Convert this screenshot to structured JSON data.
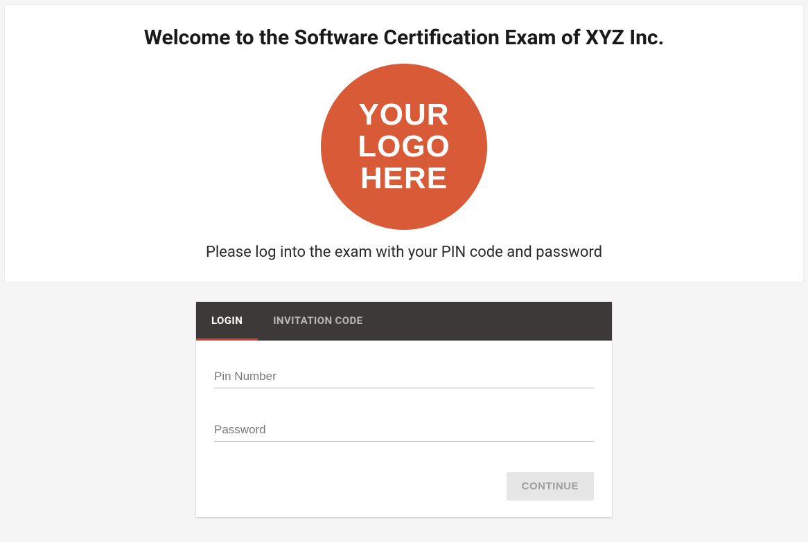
{
  "header": {
    "title": "Welcome to the Software Certification Exam of XYZ Inc.",
    "logo": {
      "line1": "YOUR",
      "line2": "LOGO",
      "line3": "HERE"
    },
    "instruction": "Please log into the exam with your PIN code and password"
  },
  "tabs": {
    "login": "LOGIN",
    "invitation": "INVITATION CODE"
  },
  "form": {
    "pin_placeholder": "Pin Number",
    "password_placeholder": "Password",
    "continue_label": "CONTINUE"
  }
}
